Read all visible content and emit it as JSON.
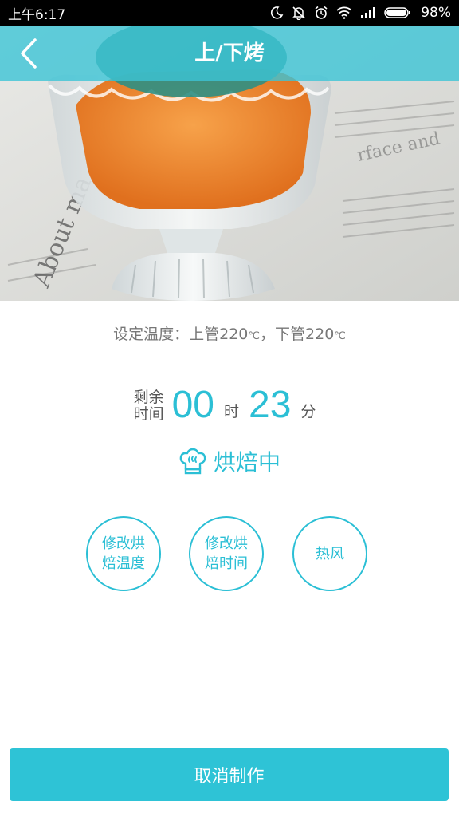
{
  "status_bar": {
    "time": "上午6:17",
    "battery_percent": "98%"
  },
  "header": {
    "title": "上/下烤"
  },
  "temperature": {
    "prefix": "设定温度：上管",
    "upper_value": "220",
    "unit": "℃",
    "separator": "，下管",
    "lower_value": "220"
  },
  "remaining": {
    "label_line1": "剩余",
    "label_line2": "时间",
    "hours": "00",
    "hours_unit": "时",
    "minutes": "23",
    "minutes_unit": "分"
  },
  "status": {
    "text": "烘焙中",
    "icon": "chef-hat-icon"
  },
  "actions": {
    "modify_temp_line1": "修改烘",
    "modify_temp_line2": "焙温度",
    "modify_time_line1": "修改烘",
    "modify_time_line2": "焙时间",
    "hot_air": "热风"
  },
  "footer": {
    "cancel_label": "取消制作"
  },
  "colors": {
    "accent": "#2bbfd5",
    "title_bar": "#3cc4d6",
    "cancel_button": "#2ec3d6"
  }
}
